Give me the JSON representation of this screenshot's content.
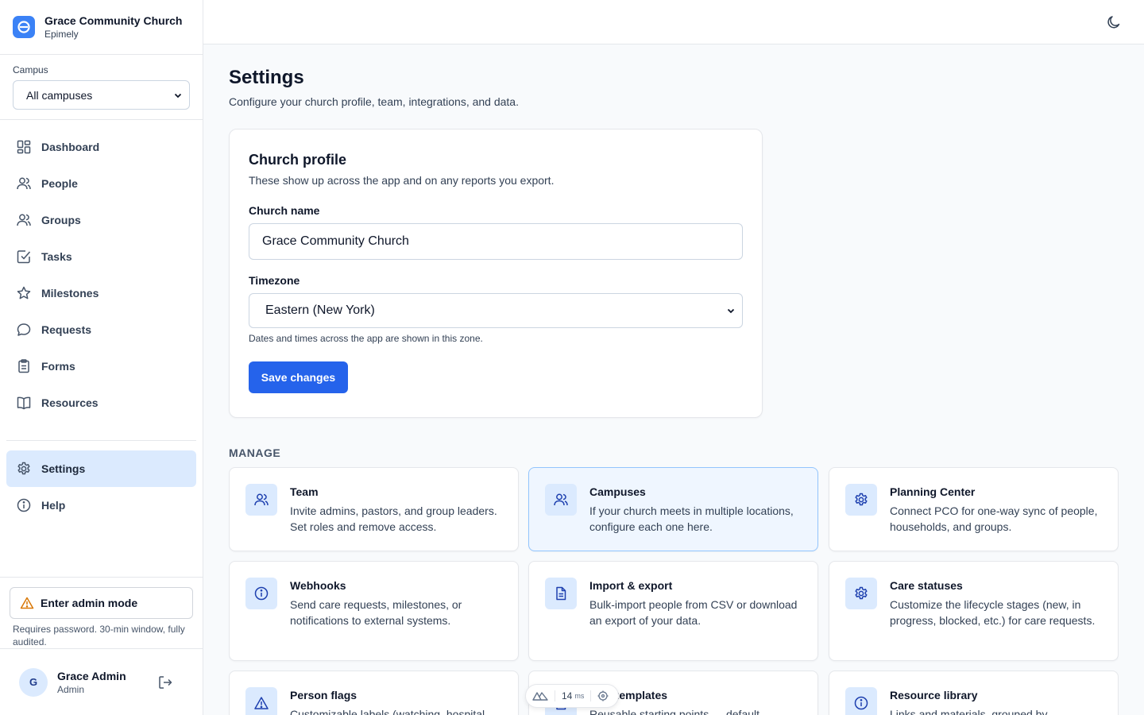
{
  "brand": {
    "name": "Grace Community Church",
    "sub": "Epimely",
    "color": "#3b82f6"
  },
  "campus": {
    "label": "Campus",
    "selected": "All campuses"
  },
  "nav": {
    "items": [
      {
        "label": "Dashboard",
        "icon": "dashboard-icon"
      },
      {
        "label": "People",
        "icon": "people-icon"
      },
      {
        "label": "Groups",
        "icon": "groups-icon"
      },
      {
        "label": "Tasks",
        "icon": "tasks-icon"
      },
      {
        "label": "Milestones",
        "icon": "star-icon"
      },
      {
        "label": "Requests",
        "icon": "message-icon"
      },
      {
        "label": "Forms",
        "icon": "clipboard-icon"
      },
      {
        "label": "Resources",
        "icon": "book-icon"
      }
    ],
    "settings": {
      "label": "Settings",
      "icon": "gear-icon",
      "active": true
    },
    "help": {
      "label": "Help",
      "icon": "info-icon"
    }
  },
  "admin": {
    "button": "Enter admin mode",
    "note": "Requires password. 30-min window, fully audited."
  },
  "user": {
    "initial": "G",
    "name": "Grace Admin",
    "role": "Admin"
  },
  "page": {
    "title": "Settings",
    "subtitle": "Configure your church profile, team, integrations, and data."
  },
  "profile": {
    "title": "Church profile",
    "subtitle": "These show up across the app and on any reports you export.",
    "name_label": "Church name",
    "name_value": "Grace Community Church",
    "tz_label": "Timezone",
    "tz_value": "Eastern (New York)",
    "tz_hint": "Dates and times across the app are shown in this zone.",
    "save": "Save changes"
  },
  "manage": {
    "label": "MANAGE",
    "tiles": [
      {
        "title": "Team",
        "desc": "Invite admins, pastors, and group leaders. Set roles and remove access.",
        "icon": "users-icon"
      },
      {
        "title": "Campuses",
        "desc": "If your church meets in multiple locations, configure each one here.",
        "icon": "users-icon"
      },
      {
        "title": "Planning Center",
        "desc": "Connect PCO for one-way sync of people, households, and groups.",
        "icon": "gear-icon"
      },
      {
        "title": "Webhooks",
        "desc": "Send care requests, milestones, or notifications to external systems.",
        "icon": "info-icon"
      },
      {
        "title": "Import & export",
        "desc": "Bulk-import people from CSV or download an export of your data.",
        "icon": "file-icon"
      },
      {
        "title": "Care statuses",
        "desc": "Customize the lifecycle stages (new, in progress, blocked, etc.) for care requests.",
        "icon": "gear-icon"
      },
      {
        "title": "Person flags",
        "desc": "Customizable labels (watching, hospital",
        "icon": "warning-icon"
      },
      {
        "title": "plan templates",
        "desc": "Reusable starting points — default",
        "icon": "file-icon"
      },
      {
        "title": "Resource library",
        "desc": "Links and materials, grouped by",
        "icon": "info-icon"
      }
    ]
  },
  "devtools": {
    "ms_value": "14",
    "ms_unit": "ms"
  }
}
